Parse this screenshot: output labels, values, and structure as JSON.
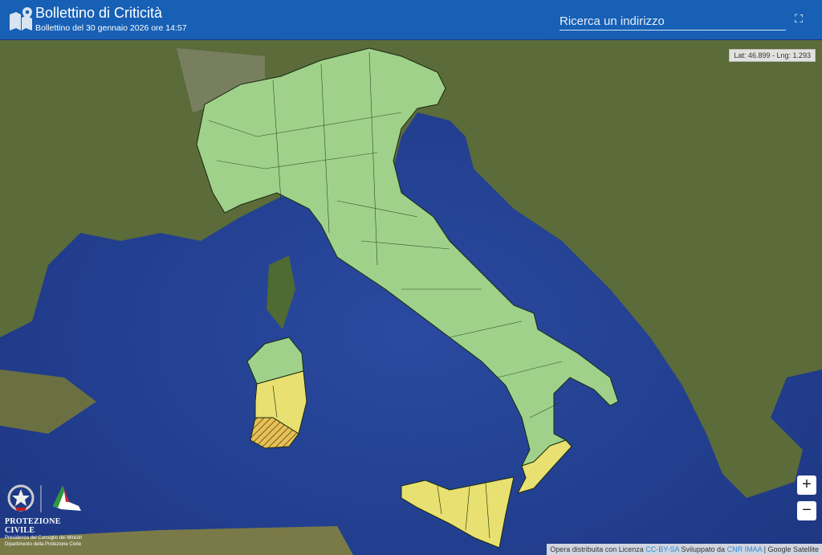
{
  "header": {
    "title": "Bollettino di Criticità",
    "subtitle": "Bollettino del 30 gennaio 2026 ore 14:57",
    "search_placeholder": "Ricerca un indirizzo",
    "icons": [
      "map-pin-icon",
      "fullscreen-icon"
    ]
  },
  "map": {
    "coordinates": "Lat: 46.899 - Lng: 1.293",
    "zoom_in": "+",
    "zoom_out": "−",
    "colors": {
      "no_alert": "#9fd18a",
      "yellow_alert": "#e8e070",
      "orange_hatched": "#d9a33a"
    }
  },
  "attribution": {
    "prefix": "Opera distribuita con Licenza",
    "license": "CC-BY-SA",
    "dev_prefix": "Sviluppato da",
    "developer": "CNR IMAA",
    "tiles": "| Google Satellite"
  },
  "logo": {
    "name": "PROTEZIONE CIVILE",
    "line1": "Presidenza del Consiglio dei Ministri",
    "line2": "Dipartimento della Protezione Civile"
  }
}
